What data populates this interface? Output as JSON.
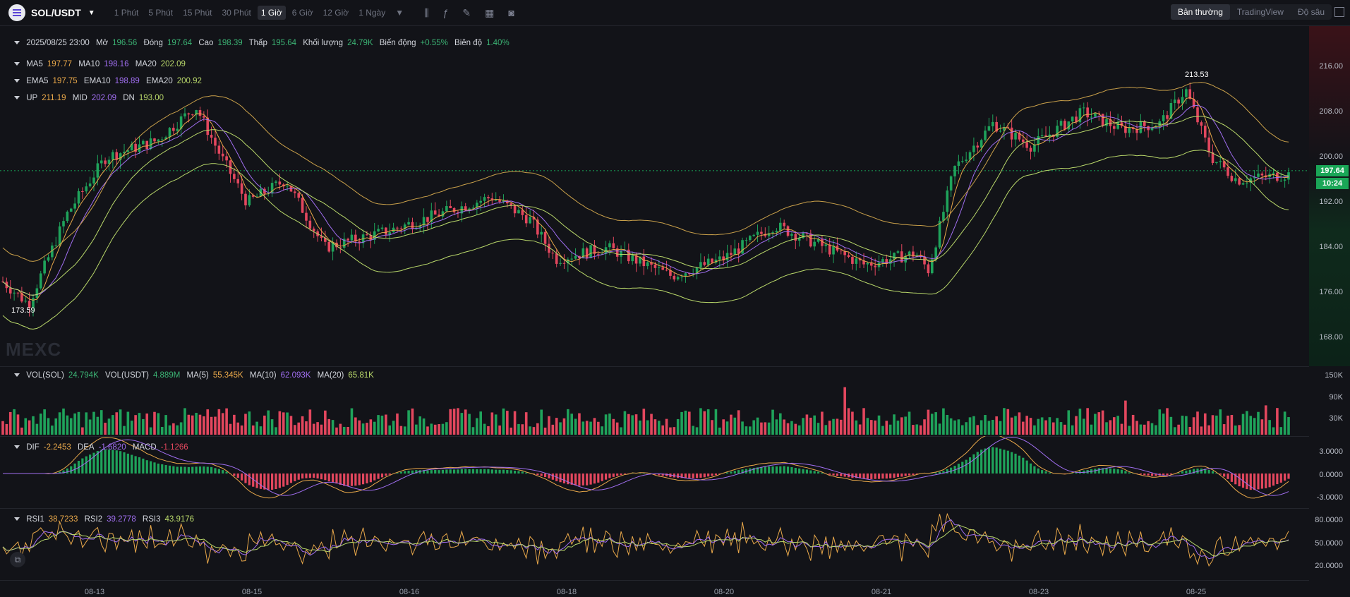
{
  "header": {
    "pair": "SOL/USDT",
    "intervals": [
      "1 Phút",
      "5 Phút",
      "15 Phút",
      "30 Phút",
      "1 Giờ",
      "6 Giờ",
      "12 Giờ",
      "1 Ngày"
    ],
    "active_interval": "1 Giờ",
    "views": [
      "Bản thường",
      "TradingView",
      "Độ sâu"
    ],
    "active_view": "Bản thường"
  },
  "ohlc": {
    "time": "2025/08/25 23:00",
    "open_label": "Mở",
    "open": "196.56",
    "close_label": "Đóng",
    "close": "197.64",
    "high_label": "Cao",
    "high": "198.39",
    "low_label": "Thấp",
    "low": "195.64",
    "vol_label": "Khối lượng",
    "vol": "24.79K",
    "change_label": "Biến động",
    "change": "+0.55%",
    "amp_label": "Biên độ",
    "amp": "1.40%"
  },
  "ma": {
    "ma5_label": "MA5",
    "ma5": "197.77",
    "ma10_label": "MA10",
    "ma10": "198.16",
    "ma20_label": "MA20",
    "ma20": "202.09"
  },
  "ema": {
    "ema5_label": "EMA5",
    "ema5": "197.75",
    "ema10_label": "EMA10",
    "ema10": "198.89",
    "ema20_label": "EMA20",
    "ema20": "200.92"
  },
  "boll": {
    "up_label": "UP",
    "up": "211.19",
    "mid_label": "MID",
    "mid": "202.09",
    "dn_label": "DN",
    "dn": "193.00"
  },
  "price_axis": [
    "216.00",
    "208.00",
    "200.00",
    "192.00",
    "184.00",
    "176.00",
    "168.00"
  ],
  "last_price": "197.64",
  "countdown": "10:24",
  "max_label": "213.53",
  "min_label": "173.59",
  "watermark": "MEXC",
  "vol": {
    "vol_sol_label": "VOL(SOL)",
    "vol_sol": "24.794K",
    "vol_usdt_label": "VOL(USDT)",
    "vol_usdt": "4.889M",
    "ma5_label": "MA(5)",
    "ma5": "55.345K",
    "ma10_label": "MA(10)",
    "ma10": "62.093K",
    "ma20_label": "MA(20)",
    "ma20": "65.81K"
  },
  "vol_axis": [
    "150K",
    "90K",
    "30K"
  ],
  "macd": {
    "dif_label": "DIF",
    "dif": "-2.2453",
    "dea_label": "DEA",
    "dea": "-1.6820",
    "macd_label": "MACD",
    "macd": "-1.1266"
  },
  "macd_axis": [
    "3.0000",
    "0.0000",
    "-3.0000"
  ],
  "rsi": {
    "rsi1_label": "RSI1",
    "rsi1": "38.7233",
    "rsi2_label": "RSI2",
    "rsi2": "39.2778",
    "rsi3_label": "RSI3",
    "rsi3": "43.9176"
  },
  "rsi_axis": [
    "80.0000",
    "50.0000",
    "20.0000"
  ],
  "dates": [
    "08-13",
    "08-15",
    "08-16",
    "08-18",
    "08-20",
    "08-21",
    "08-23",
    "08-25"
  ],
  "colors": {
    "up": "#1fa35b",
    "down": "#e3475e",
    "ma5": "#e9a84a",
    "ma10": "#a06ef0",
    "ma20": "#b9d86a",
    "bg": "#121318"
  }
}
